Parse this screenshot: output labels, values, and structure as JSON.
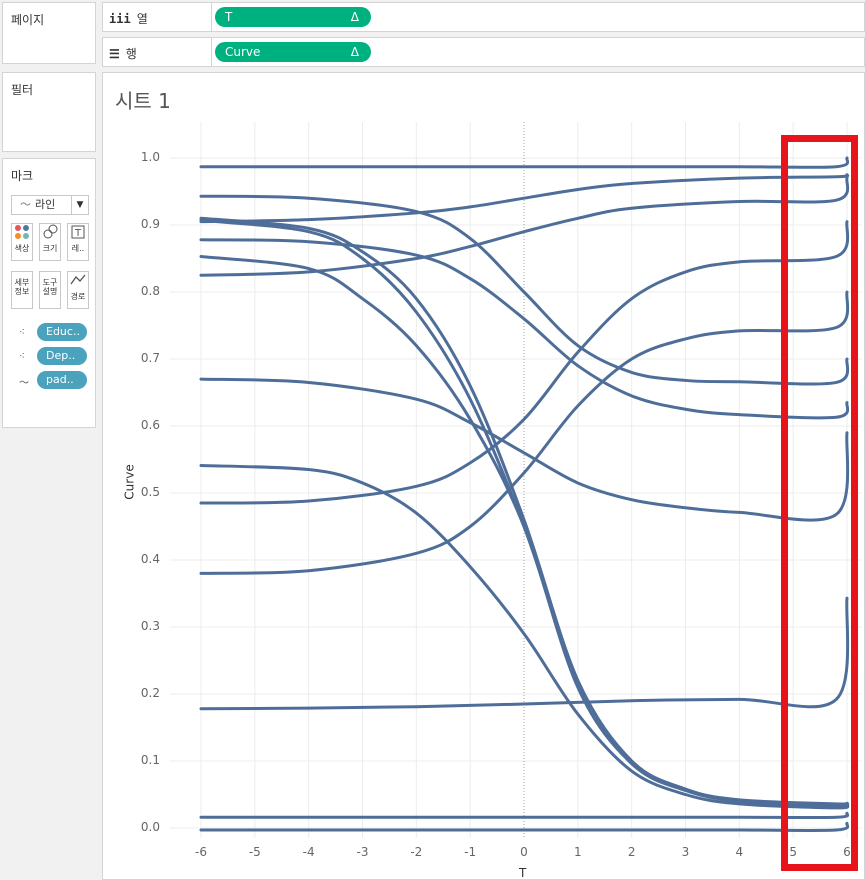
{
  "left_pane": {
    "pages_title": "페이지",
    "filters_title": "필터",
    "marks_title": "마크",
    "mark_type": "라인",
    "mark_buttons": [
      {
        "label": "색상",
        "icon": "color-dots-icon"
      },
      {
        "label": "크기",
        "icon": "size-icon"
      },
      {
        "label": "레..",
        "icon": "text-icon"
      },
      {
        "label": "세부\n정보",
        "icon": "detail-icon"
      },
      {
        "label": "도구\n설명",
        "icon": "tooltip-icon"
      },
      {
        "label": "경로",
        "icon": "path-icon"
      }
    ],
    "mark_fields": [
      "Educ..",
      "Dep..",
      "pad.."
    ]
  },
  "shelves": {
    "columns": {
      "label": "열",
      "pill": "T",
      "pill_suffix": "Δ"
    },
    "rows": {
      "label": "행",
      "pill": "Curve",
      "pill_suffix": "Δ"
    }
  },
  "sheet": {
    "title": "시트 1"
  },
  "colors": {
    "accent_pill": "#00b180",
    "field_pill": "#4aa2bd",
    "series": "#4e6e99",
    "highlight": "#e8141c"
  },
  "chart_data": {
    "type": "line",
    "title": "",
    "xlabel": "T",
    "ylabel": "Curve",
    "xlim": [
      -6,
      6
    ],
    "ylim": [
      0.0,
      1.0
    ],
    "xticks": [
      -6,
      -5,
      -4,
      -3,
      -2,
      -1,
      0,
      1,
      2,
      3,
      4,
      5,
      6
    ],
    "yticks": [
      "0.0",
      "0.1",
      "0.2",
      "0.3",
      "0.4",
      "0.5",
      "0.6",
      "0.7",
      "0.8",
      "0.9",
      "1.0"
    ],
    "grid": true,
    "series": [
      {
        "x": [
          -6,
          -4,
          -2,
          0,
          2,
          4,
          5.8,
          6
        ],
        "y": [
          0.987,
          0.987,
          0.987,
          0.987,
          0.987,
          0.987,
          0.987,
          1.0
        ]
      },
      {
        "x": [
          -6,
          -4,
          -2,
          -1,
          0,
          1,
          2,
          4,
          5.8,
          6
        ],
        "y": [
          0.905,
          0.908,
          0.918,
          0.927,
          0.94,
          0.953,
          0.962,
          0.97,
          0.972,
          0.975
        ]
      },
      {
        "x": [
          -6,
          -4,
          -2,
          -1,
          0,
          1,
          2,
          4,
          5.8,
          6
        ],
        "y": [
          0.825,
          0.83,
          0.85,
          0.868,
          0.89,
          0.91,
          0.925,
          0.935,
          0.937,
          0.97
        ]
      },
      {
        "x": [
          -6,
          -4,
          -2,
          -1,
          0,
          1,
          2,
          3,
          4,
          5.8,
          6
        ],
        "y": [
          0.485,
          0.488,
          0.51,
          0.545,
          0.61,
          0.71,
          0.79,
          0.83,
          0.845,
          0.853,
          0.905
        ]
      },
      {
        "x": [
          -6,
          -4,
          -2,
          -1,
          0,
          1,
          2,
          3,
          4,
          5.8,
          6
        ],
        "y": [
          0.38,
          0.384,
          0.41,
          0.45,
          0.53,
          0.63,
          0.7,
          0.73,
          0.742,
          0.747,
          0.8
        ]
      },
      {
        "x": [
          -6,
          -4,
          -2,
          -1,
          0,
          1,
          2,
          3,
          4,
          5.8,
          6
        ],
        "y": [
          0.943,
          0.94,
          0.92,
          0.88,
          0.8,
          0.72,
          0.68,
          0.668,
          0.666,
          0.665,
          0.7
        ]
      },
      {
        "x": [
          -6,
          -4,
          -2,
          -1,
          0,
          1,
          2,
          3,
          4,
          5.8,
          6
        ],
        "y": [
          0.878,
          0.875,
          0.855,
          0.82,
          0.76,
          0.69,
          0.645,
          0.625,
          0.617,
          0.613,
          0.635
        ]
      },
      {
        "x": [
          -6,
          -4,
          -2,
          -1,
          0,
          1,
          2,
          3,
          4,
          5.8,
          6
        ],
        "y": [
          0.67,
          0.665,
          0.64,
          0.605,
          0.56,
          0.515,
          0.49,
          0.478,
          0.471,
          0.468,
          0.59
        ]
      },
      {
        "x": [
          -6,
          -4,
          -2,
          0,
          2,
          4,
          5.8,
          6
        ],
        "y": [
          0.178,
          0.179,
          0.181,
          0.185,
          0.19,
          0.192,
          0.192,
          0.343
        ]
      },
      {
        "x": [
          -6,
          -4,
          -3,
          -2,
          -1,
          0,
          1,
          2,
          3,
          4,
          5.8,
          6
        ],
        "y": [
          0.91,
          0.895,
          0.86,
          0.79,
          0.66,
          0.46,
          0.22,
          0.1,
          0.058,
          0.042,
          0.036,
          0.037
        ]
      },
      {
        "x": [
          -6,
          -4,
          -3,
          -2,
          -1,
          0,
          1,
          2,
          3,
          4,
          5.8,
          6
        ],
        "y": [
          0.907,
          0.89,
          0.85,
          0.77,
          0.64,
          0.45,
          0.22,
          0.1,
          0.058,
          0.04,
          0.033,
          0.034
        ]
      },
      {
        "x": [
          -6,
          -4,
          -3,
          -2,
          -1,
          0,
          1,
          2,
          3,
          4,
          5.8,
          6
        ],
        "y": [
          0.853,
          0.835,
          0.79,
          0.72,
          0.61,
          0.45,
          0.21,
          0.096,
          0.056,
          0.04,
          0.032,
          0.036
        ]
      },
      {
        "x": [
          -6,
          -4,
          -3,
          -2,
          -1,
          0,
          1,
          2,
          3,
          4,
          5.8,
          6
        ],
        "y": [
          0.541,
          0.535,
          0.515,
          0.47,
          0.39,
          0.29,
          0.17,
          0.085,
          0.05,
          0.036,
          0.03,
          0.034
        ]
      },
      {
        "x": [
          -6,
          -4,
          -2,
          0,
          2,
          4,
          5.8,
          6
        ],
        "y": [
          0.016,
          0.016,
          0.016,
          0.016,
          0.016,
          0.016,
          0.016,
          0.022
        ]
      },
      {
        "x": [
          -6,
          -4,
          -2,
          0,
          2,
          4,
          5.8,
          6
        ],
        "y": [
          -0.003,
          -0.003,
          -0.003,
          -0.003,
          -0.003,
          -0.003,
          -0.003,
          0.007
        ]
      }
    ]
  }
}
